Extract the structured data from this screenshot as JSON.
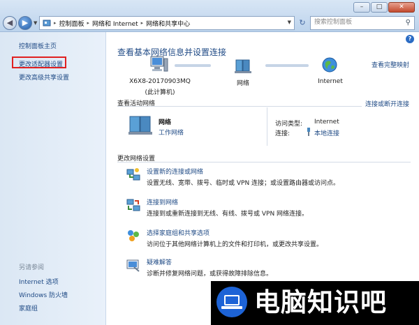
{
  "window": {
    "min_label": "–",
    "max_label": "□",
    "close_label": "✕"
  },
  "address_bar": {
    "crumbs": [
      "控制面板",
      "网络和 Internet",
      "网络和共享中心"
    ],
    "separator": "▸"
  },
  "search": {
    "placeholder": "搜索控制面板"
  },
  "sidebar": {
    "items": [
      {
        "label": "控制面板主页"
      },
      {
        "label": "更改适配器设置"
      },
      {
        "label": "更改高级共享设置"
      }
    ],
    "see_also_title": "另请参阅",
    "see_also": [
      {
        "label": "Internet 选项"
      },
      {
        "label": "Windows 防火墙"
      },
      {
        "label": "家庭组"
      }
    ]
  },
  "main": {
    "title": "查看基本网络信息并设置连接",
    "full_map_link": "查看完整映射",
    "map": {
      "computer_name": "X6X8-20170903MQ",
      "computer_sub": "(此计算机)",
      "network_label": "网络",
      "internet_label": "Internet"
    },
    "active_section": {
      "title": "查看活动网络",
      "connect_link": "连接或断开连接",
      "network_name": "网络",
      "network_type": "工作网络",
      "access_type_label": "访问类型:",
      "access_type_value": "Internet",
      "connections_label": "连接:",
      "connections_value": "本地连接"
    },
    "change_section": {
      "title": "更改网络设置",
      "tasks": [
        {
          "title": "设置新的连接或网络",
          "desc": "设置无线、宽带、拨号、临时或 VPN 连接；或设置路由器或访问点。",
          "icon": "new-connection-icon"
        },
        {
          "title": "连接到网络",
          "desc": "连接到或重新连接到无线、有线、拨号或 VPN 网络连接。",
          "icon": "connect-network-icon"
        },
        {
          "title": "选择家庭组和共享选项",
          "desc": "访问位于其他网络计算机上的文件和打印机，或更改共享设置。",
          "icon": "homegroup-icon"
        },
        {
          "title": "疑难解答",
          "desc": "诊断并修复网络问题，或获得故障排除信息。",
          "icon": "troubleshoot-icon"
        }
      ]
    }
  },
  "watermark": {
    "text": "电脑知识吧"
  }
}
